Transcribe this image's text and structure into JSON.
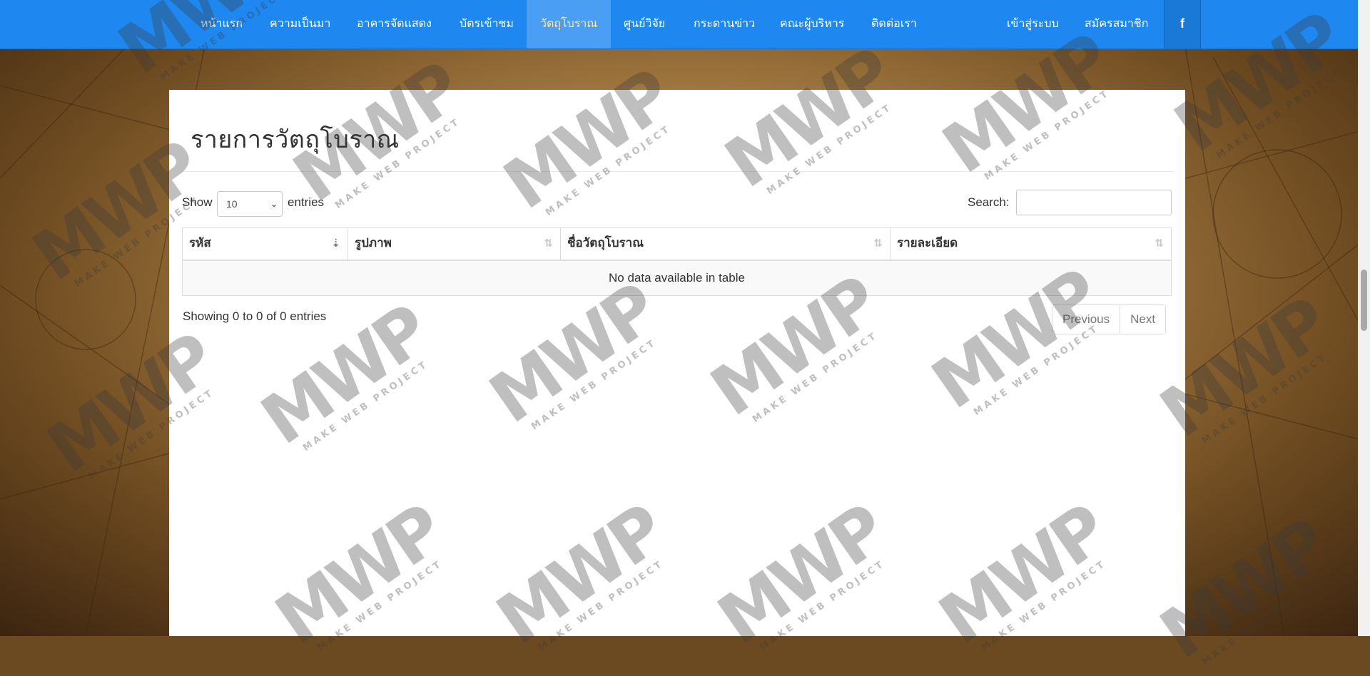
{
  "nav": {
    "items": [
      {
        "label": "หน้าแรก"
      },
      {
        "label": "ความเป็นมา"
      },
      {
        "label": "อาคารจัดแสดง"
      },
      {
        "label": "บัตรเข้าชม"
      },
      {
        "label": "วัตถุโบราณ"
      },
      {
        "label": "ศูนย์วิจัย"
      },
      {
        "label": "กระดานข่าว"
      },
      {
        "label": "คณะผู้บริหาร"
      },
      {
        "label": "ติดต่อเรา"
      }
    ],
    "active_index": 4,
    "login": "เข้าสู่ระบบ",
    "register": "สมัครสมาชิก",
    "facebook": "f"
  },
  "page": {
    "title": "รายการวัตถุโบราณ"
  },
  "table_controls": {
    "show_label": "Show",
    "entries_value": "10",
    "entries_label": "entries",
    "search_label": "Search:",
    "search_value": ""
  },
  "table": {
    "columns": [
      "รหัส",
      "รูปภาพ",
      "ชื่อวัตถุโบราณ",
      "รายละเอียด"
    ],
    "empty_message": "No data available in table",
    "info": "Showing 0 to 0 of 0 entries",
    "previous": "Previous",
    "next": "Next"
  },
  "watermark": {
    "logo": "MWP",
    "tagline": "MAKE WEB PROJECT"
  },
  "colors": {
    "navbar": "#1e88f0",
    "active_nav_text": "#ffe79a"
  }
}
